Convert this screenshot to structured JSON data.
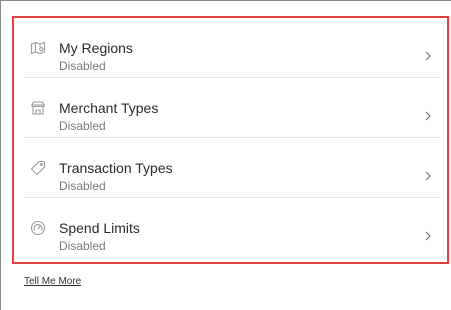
{
  "controls": {
    "items": [
      {
        "title": "My Regions",
        "status": "Disabled",
        "icon": "map-icon"
      },
      {
        "title": "Merchant Types",
        "status": "Disabled",
        "icon": "store-icon"
      },
      {
        "title": "Transaction Types",
        "status": "Disabled",
        "icon": "tag-icon"
      },
      {
        "title": "Spend Limits",
        "status": "Disabled",
        "icon": "gauge-icon"
      }
    ],
    "chevron_icon": "chevron-right-icon"
  },
  "footer": {
    "link_label": "Tell Me More"
  },
  "colors": {
    "highlight_border": "#e5403f",
    "icon": "#9a9a9a",
    "title_text": "#2b2b2b",
    "status_text": "#7a7a7a"
  }
}
